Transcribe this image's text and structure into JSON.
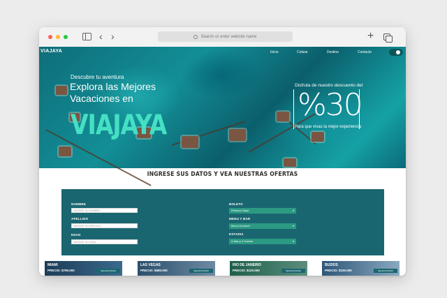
{
  "browser": {
    "url_placeholder": "Search or enter website name"
  },
  "site": {
    "logo": "VIAJAYA",
    "menu": [
      "Inicio",
      "Cotizar",
      "Destino",
      "Contacto"
    ]
  },
  "hero": {
    "kicker": "Descubre tu aventura",
    "headline": "Explora las Mejores Vacaciones en",
    "brand": "VIAJAYA",
    "promo_caption": "Disfruta de nuestro descuento del",
    "promo_value": "%30",
    "promo_subcaption": "Para que vivas la mejor experiencia"
  },
  "form": {
    "heading": "INGRESE SUS DATOS Y VEA NUESTRAS OFERTAS",
    "nombre_label": "NOMBRE",
    "nombre_placeholder": "INGRESE SU NOMBRE",
    "apellido_label": "APELLIDO",
    "apellido_placeholder": "INGRESE SU APELLIDO",
    "edad_label": "EDAD",
    "edad_placeholder": "INGRESE SU EDAD",
    "boleto_label": "BOLETO",
    "boleto_value": "Primera Clase",
    "menu_label": "MENU Y BAR",
    "menu_value": "Menu Gourmet",
    "estadia_label": "ESTADIA",
    "estadia_value": "3 dias y 2 noches"
  },
  "destinations": [
    {
      "city": "MIAMI",
      "price": "PRECIO: $790.000",
      "button": "SELECCIONAR"
    },
    {
      "city": "LAS VEGAS",
      "price": "PRECIO: $680.000",
      "button": "SELECCIONAR"
    },
    {
      "city": "RIO DE JANEIRO",
      "price": "PRECIO: $120.000",
      "button": "SELECCIONAR"
    },
    {
      "city": "BUZIOS",
      "price": "PRECIO: $100.000",
      "button": "SELECCIONAR"
    }
  ],
  "colors": {
    "brand_accent": "#45e0c4",
    "form_panel": "#1a6670",
    "select_fill": "#2c9a83"
  }
}
